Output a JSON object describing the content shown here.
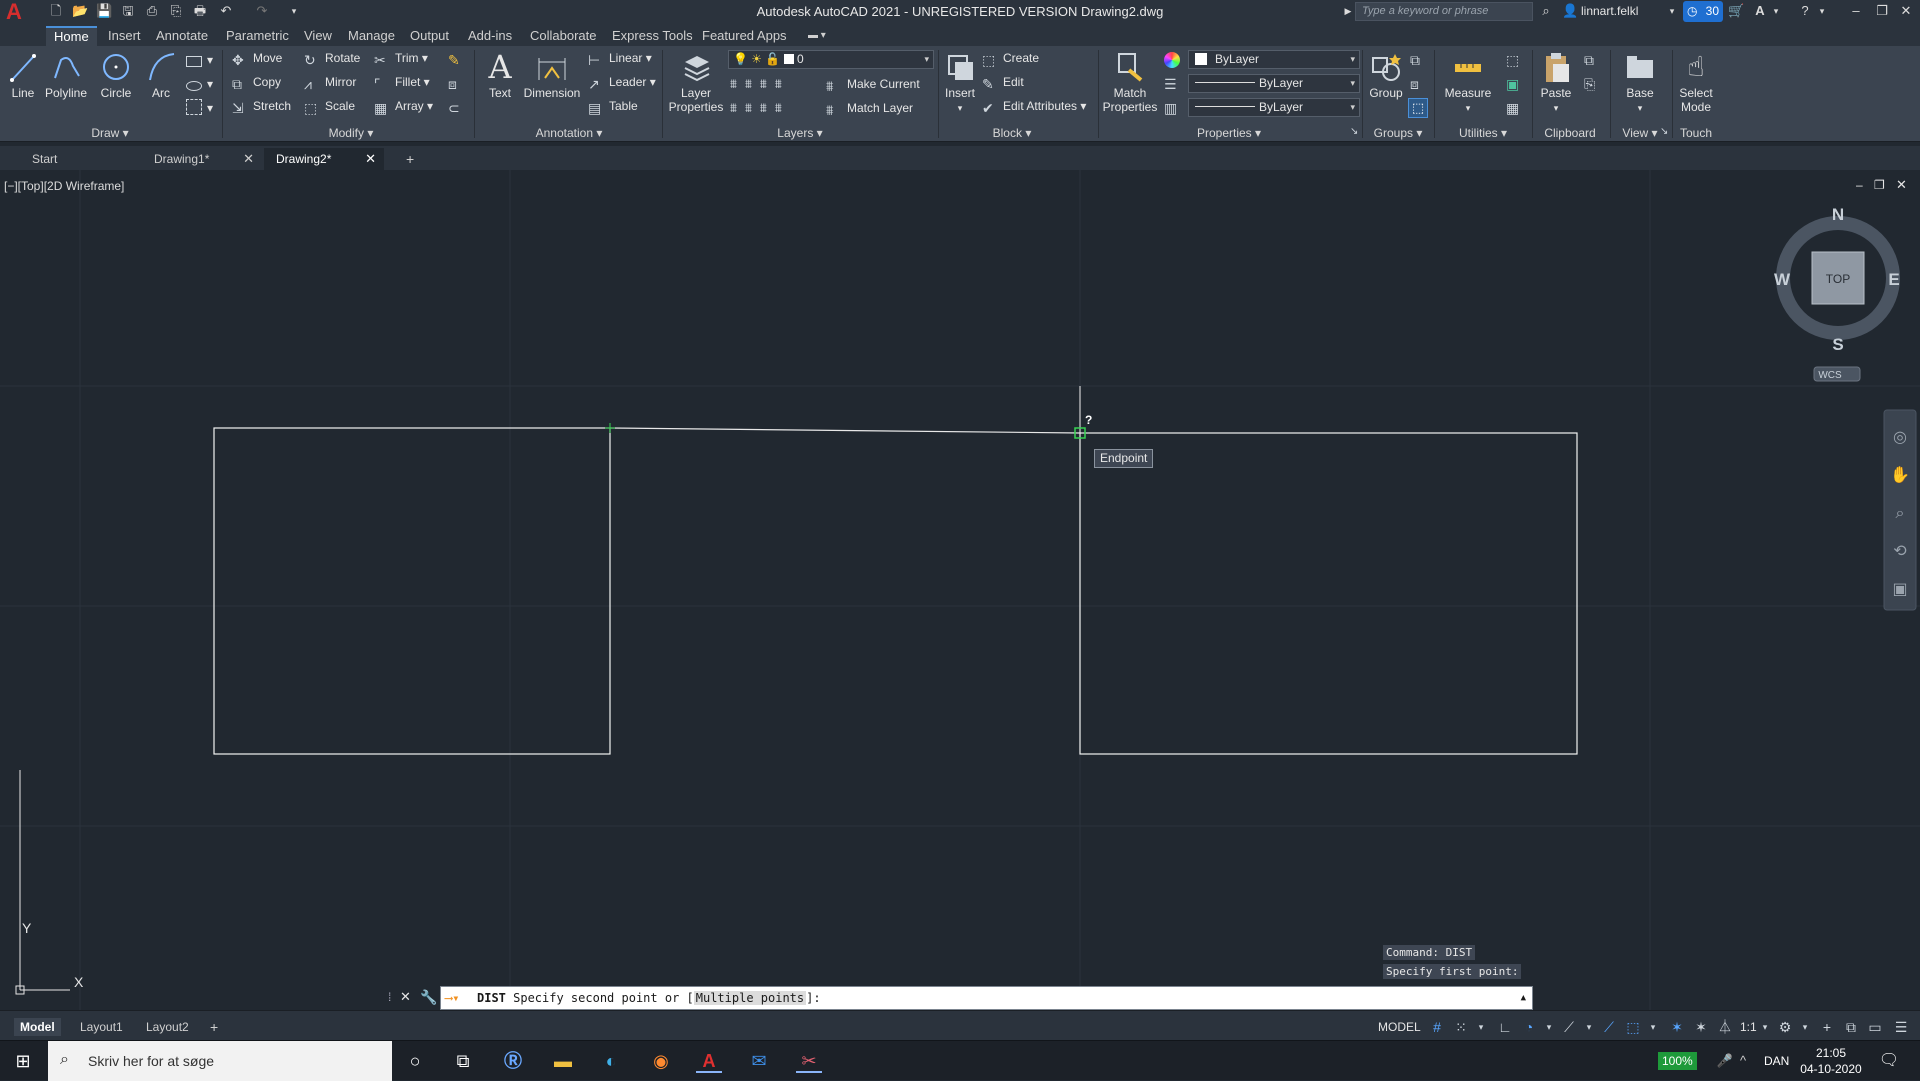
{
  "app": {
    "title": "Autodesk AutoCAD 2021 - UNREGISTERED VERSION    Drawing2.dwg",
    "search_placeholder": "Type a keyword or phrase",
    "user": "linnart.felkl",
    "badge_count": "30"
  },
  "menu_tabs": [
    "Home",
    "Insert",
    "Annotate",
    "Parametric",
    "View",
    "Manage",
    "Output",
    "Add-ins",
    "Collaborate",
    "Express Tools",
    "Featured Apps"
  ],
  "ribbon": {
    "draw": {
      "title": "Draw",
      "line": "Line",
      "polyline": "Polyline",
      "circle": "Circle",
      "arc": "Arc"
    },
    "modify": {
      "title": "Modify",
      "move": "Move",
      "rotate": "Rotate",
      "trim": "Trim",
      "copy": "Copy",
      "mirror": "Mirror",
      "fillet": "Fillet",
      "stretch": "Stretch",
      "scale": "Scale",
      "array": "Array"
    },
    "annotation": {
      "title": "Annotation",
      "text": "Text",
      "dimension": "Dimension",
      "linear": "Linear",
      "leader": "Leader",
      "table": "Table"
    },
    "layers": {
      "title": "Layers",
      "layer_properties_1": "Layer",
      "layer_properties_2": "Properties",
      "layer_value": "0",
      "make_current": "Make Current",
      "match_layer": "Match Layer"
    },
    "block": {
      "title": "Block",
      "insert": "Insert",
      "create": "Create",
      "edit": "Edit",
      "edit_attributes": "Edit Attributes"
    },
    "properties": {
      "title": "Properties",
      "match_1": "Match",
      "match_2": "Properties",
      "color": "ByLayer",
      "linetype": "ByLayer",
      "lineweight": "ByLayer"
    },
    "groups": {
      "title": "Groups",
      "group": "Group"
    },
    "utilities": {
      "title": "Utilities",
      "measure": "Measure"
    },
    "clipboard": {
      "title": "Clipboard",
      "paste": "Paste"
    },
    "view": {
      "title": "View",
      "base": "Base"
    },
    "touch": {
      "title": "Touch",
      "select_1": "Select",
      "select_2": "Mode"
    }
  },
  "doc_tabs": [
    {
      "label": "Start"
    },
    {
      "label": "Drawing1*"
    },
    {
      "label": "Drawing2*"
    }
  ],
  "viewport": {
    "label": "[−][Top][2D Wireframe]",
    "tooltip": "Endpoint",
    "cursor_mark": "?",
    "viewcube": {
      "n": "N",
      "s": "S",
      "e": "E",
      "w": "W",
      "top": "TOP",
      "wcs": "WCS"
    },
    "ucs": {
      "x": "X",
      "y": "Y"
    }
  },
  "command": {
    "history": [
      "Command: DIST",
      "Specify first point:"
    ],
    "prompt_cmd": "DIST",
    "prompt_text": " Specify second point or [",
    "prompt_option": "Multiple points",
    "prompt_end": "]:"
  },
  "layout_tabs": [
    "Model",
    "Layout1",
    "Layout2"
  ],
  "status": {
    "model": "MODEL",
    "scale": "1:1"
  },
  "taskbar": {
    "search": "Skriv her for at søge",
    "battery": "100%",
    "lang": "DAN",
    "time": "21:05",
    "date": "04-10-2020"
  },
  "colors": {
    "canvas": "#212830",
    "ribbon": "#3b4450",
    "accent": "#4a90d9",
    "snap": "#39d353"
  }
}
